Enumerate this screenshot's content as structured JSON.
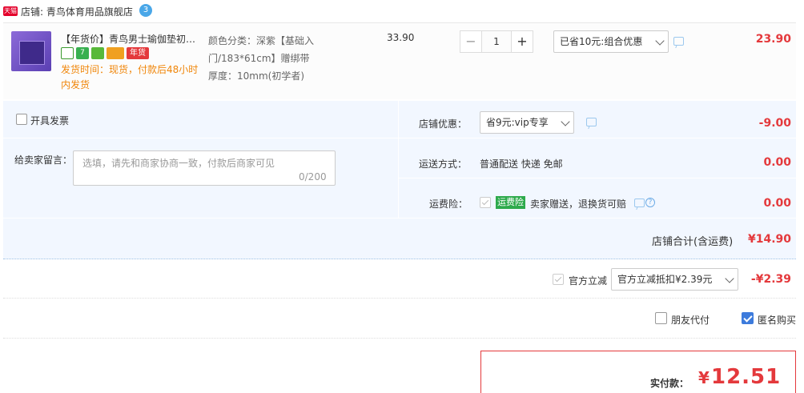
{
  "shop": {
    "badge": "天猫",
    "label": "店铺: 青鸟体育用品旗舰店",
    "ww_badge": "3"
  },
  "item": {
    "title": "【年货价】青鸟男士瑜伽垫初学者加宽加厚加长防滑健身垫子",
    "tags": [
      {
        "icon": "certified-icon",
        "text": ""
      },
      {
        "icon": "seven-day-return-icon",
        "text": "7"
      },
      {
        "icon": "coupon-icon",
        "text": ""
      },
      {
        "icon": "credit-card-icon",
        "text": ""
      },
      {
        "icon": "new-year-icon",
        "text": "年货"
      }
    ],
    "ship_time": "发货时间：现货，付款后48小时内发货",
    "sku_lines": [
      "颜色分类：深紫【基础入门/183*61cm】赠绑带",
      "厚度：10mm(初学者)"
    ],
    "unit_price": "33.90",
    "quantity": "1",
    "discount_select": "已省10元:组合优惠",
    "total": "23.90"
  },
  "extras": {
    "invoice_label": "开具发票",
    "memo_label": "给卖家留言：",
    "memo_placeholder": "选填，请先和商家协商一致，付款后商家可见",
    "memo_count": "0/200",
    "shop_discount_label": "店铺优惠：",
    "shop_discount_select": "省9元:vip专享",
    "shop_discount_value": "-9.00",
    "shipping_label": "运送方式：",
    "shipping_method": "普通配送 快递 免邮",
    "shipping_value": "0.00",
    "insurance_label": "运费险：",
    "insurance_badge": "运费险",
    "insurance_text": "卖家赠送，退换货可赔",
    "insurance_value": "0.00"
  },
  "subtotal": {
    "label": "店铺合计(含运费)",
    "value": "¥14.90"
  },
  "official": {
    "label": "官方立减",
    "select": "官方立减抵扣¥2.39元",
    "value": "-¥2.39"
  },
  "options": {
    "friend_pay": "朋友代付",
    "anonymous": "匿名购买"
  },
  "pay": {
    "label": "实付款：",
    "currency": "¥",
    "value": "12.51"
  },
  "colors": {
    "accent": "#e4393c",
    "panel": "#f2f7ff",
    "checkbox": "#3d7bdc"
  }
}
